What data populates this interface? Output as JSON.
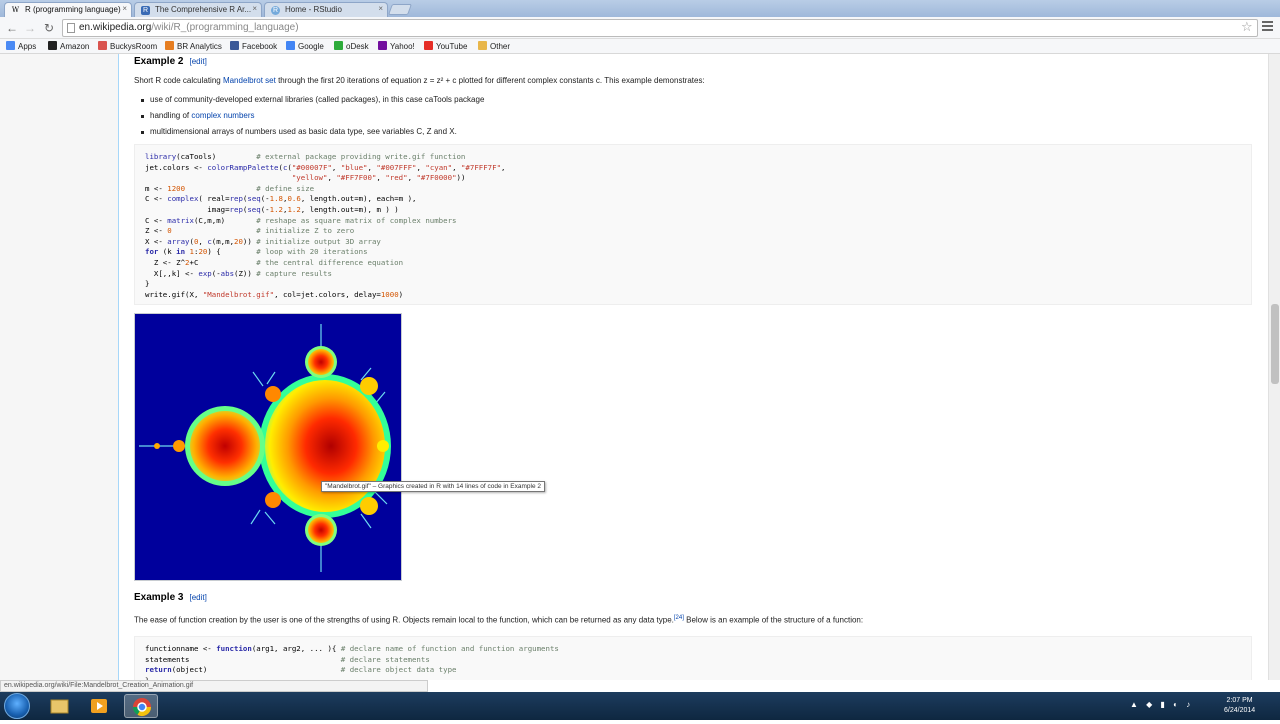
{
  "tabs": [
    {
      "label": "R (programming language)",
      "active": true,
      "favicon": "W"
    },
    {
      "label": "The Comprehensive R Ar...",
      "active": false,
      "favicon": "R"
    },
    {
      "label": "Home - RStudio",
      "active": false,
      "favicon": "R"
    }
  ],
  "omnibox": {
    "host": "en.wikipedia.org",
    "path": "/wiki/R_(programming_language)"
  },
  "bookmarks": [
    {
      "label": "Apps",
      "icon": "apps-icon",
      "color": "#4a8af4"
    },
    {
      "label": "Amazon",
      "icon": "amazon-icon",
      "color": "#222"
    },
    {
      "label": "BuckysRoom",
      "icon": "buckysroom-icon",
      "color": "#d9534f"
    },
    {
      "label": "BR Analytics",
      "icon": "analytics-icon",
      "color": "#e67e22"
    },
    {
      "label": "Facebook",
      "icon": "facebook-icon",
      "color": "#3b5998"
    },
    {
      "label": "Google",
      "icon": "google-icon",
      "color": "#4285f4"
    },
    {
      "label": "oDesk",
      "icon": "odesk-icon",
      "color": "#2dab3a"
    },
    {
      "label": "Yahoo!",
      "icon": "yahoo-icon",
      "color": "#720e9e"
    },
    {
      "label": "YouTube",
      "icon": "youtube-icon",
      "color": "#e52d27"
    },
    {
      "label": "Other",
      "icon": "folder-icon",
      "color": "#e8b64a"
    }
  ],
  "example2": {
    "heading": "Example 2",
    "edit": "[edit]",
    "intro_pre": "Short R code calculating ",
    "intro_link": "Mandelbrot set",
    "intro_post": " through the first 20 iterations of equation z = z² + c plotted for different complex constants c. This example demonstrates:",
    "bullets": [
      {
        "pre": "use of community-developed external libraries (called packages), in this case caTools package",
        "link": "",
        "post": ""
      },
      {
        "pre": "handling of ",
        "link": "complex numbers",
        "post": ""
      },
      {
        "pre": "multidimensional arrays of numbers used as basic data type, see variables C, Z and X.",
        "link": "",
        "post": ""
      }
    ]
  },
  "code1": [
    "library(caTools)         # external package providing write.gif function",
    "jet.colors <- colorRampPalette(c(\"#00007F\", \"blue\", \"#007FFF\", \"cyan\", \"#7FFF7F\",",
    "                                 \"yellow\", \"#FF7F00\", \"red\", \"#7F0000\"))",
    "m <- 1200                # define size",
    "C <- complex( real=rep(seq(-1.8,0.6, length.out=m), each=m ),",
    "              imag=rep(seq(-1.2,1.2, length.out=m), m ) )",
    "C <- matrix(C,m,m)       # reshape as square matrix of complex numbers",
    "Z <- 0                   # initialize Z to zero",
    "X <- array(0, c(m,m,20)) # initialize output 3D array",
    "for (k in 1:20) {        # loop with 20 iterations",
    "  Z <- Z^2+C             # the central difference equation",
    "  X[,,k] <- exp(-abs(Z)) # capture results",
    "}",
    "write.gif(X, \"Mandelbrot.gif\", col=jet.colors, delay=1000)"
  ],
  "tooltip": "\"Mandelbrot.gif\" – Graphics created in R with 14 lines of code in Example 2",
  "example3": {
    "heading": "Example 3",
    "edit": "[edit]",
    "text": "The ease of function creation by the user is one of the strengths of using R. Objects remain local to the function, which can be returned as any data type.",
    "ref": "[24]",
    "text2": " Below is an example of the structure of a function:"
  },
  "code2": [
    "functionname <- function(arg1, arg2, ... ){ # declare name of function and function arguments",
    "statements                                  # declare statements",
    "return(object)                              # declare object data type",
    "}"
  ],
  "status_url": "en.wikipedia.org/wiki/File:Mandelbrot_Creation_Animation.gif",
  "clock": {
    "time": "2:07 PM",
    "date": "6/24/2014"
  }
}
